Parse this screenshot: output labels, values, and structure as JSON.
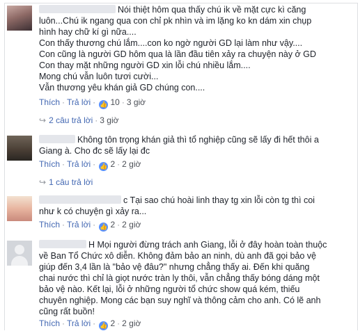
{
  "comments": [
    {
      "lines": [
        "Nói thiệt hôm qua thấy chú ik về mặt cực kì căng",
        "luôn...Chú ik ngang qua con chỉ pk nhìn và im lặng ko kn dám xin chụp",
        "hình hay chữ kí gì nữa....",
        "Con thấy thương chú lắm....con ko ngờ người GD lại làm như vậy....",
        "Con cũng là người GD hôm qua là lần đầu tiên xảy ra chuyện này ở GD",
        "Con thay mặt những người GD xin lỗi chú nhiều lắm....",
        "Mong chú vẫn luôn tươi cười...",
        "Vẫn thương yêu khán giả GD chúng con...."
      ],
      "like_label": "Thích",
      "reply_label": "Trả lời",
      "reactions": "10",
      "time": "3 giờ",
      "replies_label": "2 câu trả lời",
      "replies_time": "3 giờ"
    },
    {
      "lines": [
        "Không tôn trọng khán giả thì tổ nghiệp cũng sẽ lấy đi hết thôi a",
        "Giang à. Cho đc sẽ lấy lại đc"
      ],
      "like_label": "Thích",
      "reply_label": "Trả lời",
      "reactions": "2",
      "time": "2 giờ",
      "replies_label": "1 câu trả lời"
    },
    {
      "lines": [
        "c Tại sao chú hoài linh thay tg xin lỗi còn tg thì coi",
        "như k có chuyện gì xảy ra..."
      ],
      "like_label": "Thích",
      "reply_label": "Trả lời",
      "reactions": "2",
      "time": "2 giờ"
    },
    {
      "lines": [
        "H Mọi người đừng trách anh Giang, lỗi ở đây hoàn toàn thuộc",
        "về Ban Tổ Chức xô diễn. Không đảm bảo an ninh, dù anh đã gọi bảo vệ",
        "giúp đến 3,4 lần là \"bảo vệ đâu?\" nhưng chẳng thấy ai. Đến khi quăng",
        "chai nước thì chỉ là giọt nước tràn ly thôi, vẫn chẳng thấy bóng dáng một",
        "bảo vệ nào. Kết lại, lỗi ở những người tổ chức show quá kém, thiếu",
        "chuyên nghiệp. Mong các bạn suy nghĩ và thông cảm cho anh. Có lẽ anh",
        "cũng rất buồn!"
      ],
      "like_label": "Thích",
      "reply_label": "Trả lời",
      "reactions": "2",
      "time": "2 giờ"
    }
  ],
  "colors": {
    "link": "#4267b2",
    "like_badge": "#5890ff",
    "meta": "#90949c"
  },
  "icons": {
    "like_badge": "thumbs-up-icon",
    "reply_arrow": "reply-arrow-icon"
  }
}
